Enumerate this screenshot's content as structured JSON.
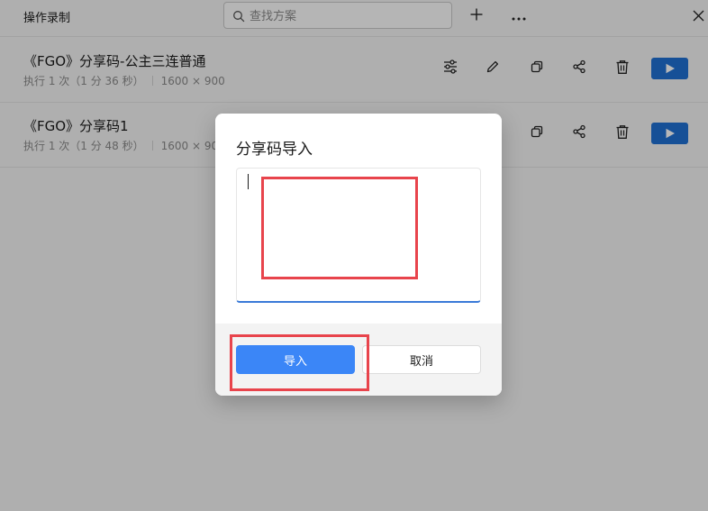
{
  "header": {
    "title": "操作录制",
    "search_placeholder": "查找方案",
    "icons": [
      "search-icon",
      "plus-icon",
      "more-icon",
      "close-icon"
    ]
  },
  "list": {
    "items": [
      {
        "title": "《FGO》分享码-公主三连普通",
        "runs": "执行 1 次（1 分 36 秒）",
        "resolution": "1600 × 900",
        "actions": [
          "settings-sliders-icon",
          "edit-pencil-icon",
          "copy-icon",
          "share-icon",
          "delete-icon",
          "play-icon"
        ]
      },
      {
        "title": "《FGO》分享码1",
        "runs": "执行 1 次（1 分 48 秒）",
        "resolution": "1600 × 900",
        "actions": [
          "copy-icon",
          "share-icon",
          "delete-icon",
          "play-icon"
        ]
      }
    ]
  },
  "dialog": {
    "title": "分享码导入",
    "input_value": "",
    "import_label": "导入",
    "cancel_label": "取消"
  },
  "colors": {
    "play": "#1f6fd1",
    "primary": "#3b86f7",
    "annotation": "#e8444c",
    "focus_underline": "#3a7ad8"
  }
}
